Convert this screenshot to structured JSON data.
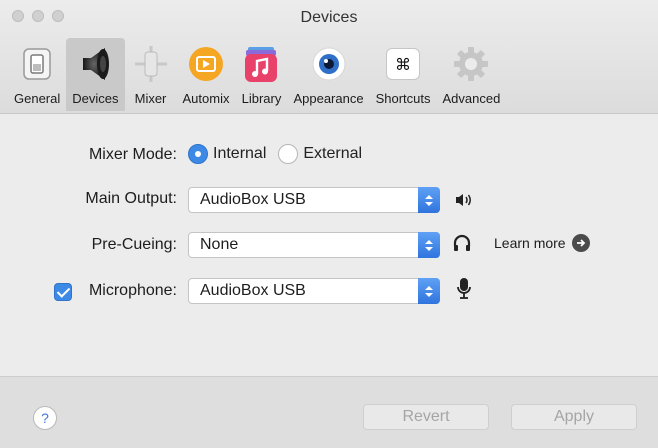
{
  "window": {
    "title": "Devices"
  },
  "toolbar": {
    "tabs": [
      {
        "label": "General",
        "icon": "switch-icon"
      },
      {
        "label": "Devices",
        "icon": "speaker-icon",
        "active": true
      },
      {
        "label": "Mixer",
        "icon": "mixer-sliders-icon"
      },
      {
        "label": "Automix",
        "icon": "automix-icon"
      },
      {
        "label": "Library",
        "icon": "music-library-icon"
      },
      {
        "label": "Appearance",
        "icon": "eye-icon"
      },
      {
        "label": "Shortcuts",
        "icon": "command-key-icon"
      },
      {
        "label": "Advanced",
        "icon": "gear-icon"
      }
    ],
    "shortcut_glyph": "⌘"
  },
  "devices": {
    "mixer_mode": {
      "label": "Mixer Mode:",
      "options": [
        "Internal",
        "External"
      ],
      "selected": "Internal"
    },
    "main_output": {
      "label": "Main Output:",
      "value": "AudioBox USB",
      "icon": "speaker-volume-icon"
    },
    "pre_cueing": {
      "label": "Pre-Cueing:",
      "value": "None",
      "icon": "headphones-icon",
      "learn_more": "Learn more"
    },
    "microphone": {
      "label": "Microphone:",
      "value": "AudioBox USB",
      "enabled": true,
      "icon": "microphone-icon"
    }
  },
  "footer": {
    "help": "?",
    "revert": "Revert",
    "apply": "Apply"
  },
  "colors": {
    "accent": "#3d8ae6",
    "automix": "#f5a623",
    "library": "#e8416a"
  }
}
